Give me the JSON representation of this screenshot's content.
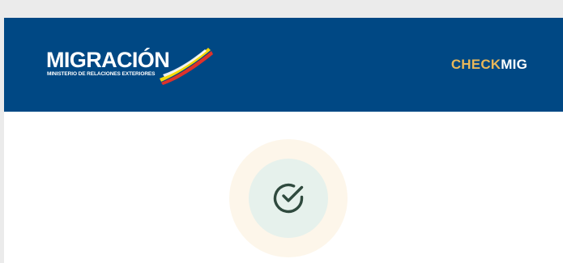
{
  "header": {
    "logo": {
      "title": "MIGRACIÓN",
      "subtitle": "MINISTERIO DE RELACIONES EXTERIORES",
      "flag_colors": [
        "#f5d90a",
        "#e0322a",
        "#ffffff"
      ]
    },
    "brand": {
      "part1": "CHECK",
      "part2": "MIG"
    },
    "background_color": "#004884"
  },
  "status": {
    "icon": "check-circle-icon",
    "icon_color": "#2f4a3e",
    "outer_ring_color": "#fdf6ea",
    "inner_circle_color": "#e6f1ec"
  }
}
